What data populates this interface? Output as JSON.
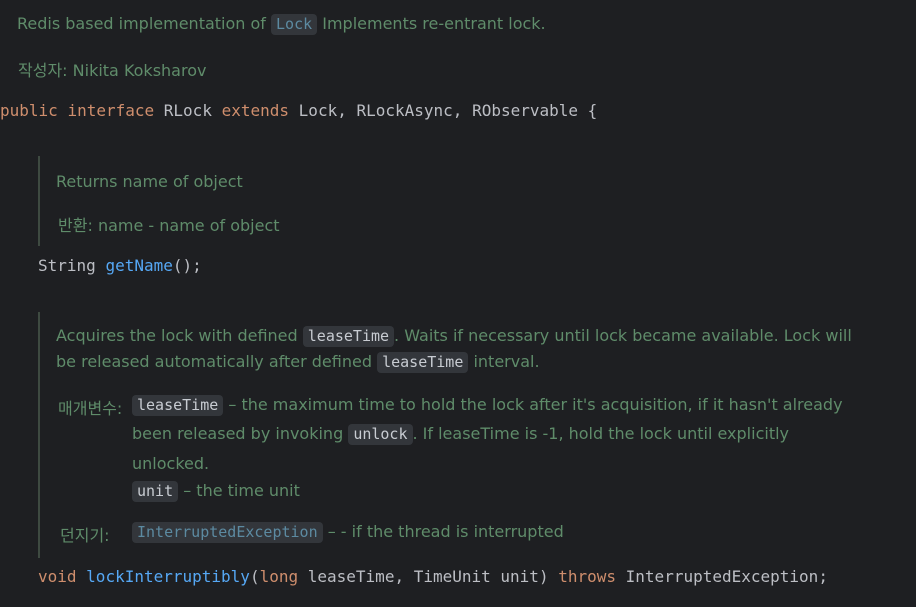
{
  "class_doc": {
    "line1_pre": "Redis based implementation of",
    "line1_chip": "Lock",
    "line1_post": "Implements re-entrant lock.",
    "author_label": "작성자:",
    "author_name": "Nikita Koksharov"
  },
  "decl": {
    "kw_public": "public",
    "kw_interface": "interface",
    "name": "RLock",
    "kw_extends": "extends",
    "supers": "Lock, RLockAsync, RObservable {"
  },
  "getname_doc": {
    "desc": "Returns name of object",
    "returns_label": "반환:",
    "returns_text": "name - name of object"
  },
  "getname_sig": {
    "type": "String",
    "method": "getName",
    "rest": "();"
  },
  "lock_doc": {
    "p1_a": "Acquires the lock with defined",
    "p1_chip1": "leaseTime",
    "p1_b": ". Waits if necessary until lock became available. Lock will",
    "p2_a": "be released automatically after defined",
    "p2_chip": "leaseTime",
    "p2_b": "interval.",
    "params_label": "매개변수:",
    "param1_chip": "leaseTime",
    "param1_text_a": "– the maximum time to hold the lock after it's acquisition, if it hasn't already",
    "param1_text_b_pre": "been released by invoking",
    "param1_text_b_chip": "unlock",
    "param1_text_b_post": ". If leaseTime is -1, hold the lock until explicitly",
    "param1_text_c": "unlocked.",
    "param2_chip": "unit",
    "param2_text": "– the time unit",
    "throws_label": "던지기:",
    "throws_chip": "InterruptedException",
    "throws_text": "– - if the thread is interrupted"
  },
  "lock_sig": {
    "kw_void": "void",
    "method": "lockInterruptibly",
    "open": "(",
    "kw_long": "long",
    "params": "leaseTime, TimeUnit unit)",
    "kw_throws": "throws",
    "exc": "InterruptedException;"
  }
}
